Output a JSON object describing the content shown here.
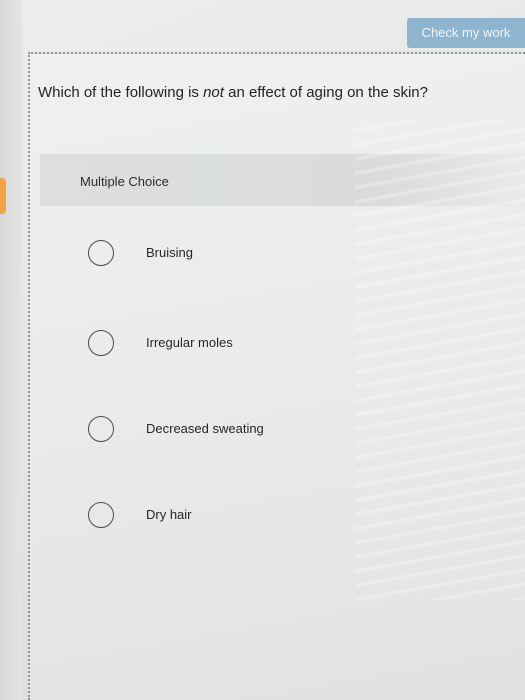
{
  "toolbar": {
    "check_label": "Check my work"
  },
  "question": {
    "prefix": "Which of the following is ",
    "emphasis": "not",
    "suffix": " an effect of aging on the skin?"
  },
  "question_type": "Multiple Choice",
  "choices": [
    {
      "label": "Bruising"
    },
    {
      "label": "Irregular moles"
    },
    {
      "label": "Decreased sweating"
    },
    {
      "label": "Dry hair"
    }
  ],
  "colors": {
    "button_bg": "#8fb4cf",
    "accent_tab": "#f0a24a"
  }
}
